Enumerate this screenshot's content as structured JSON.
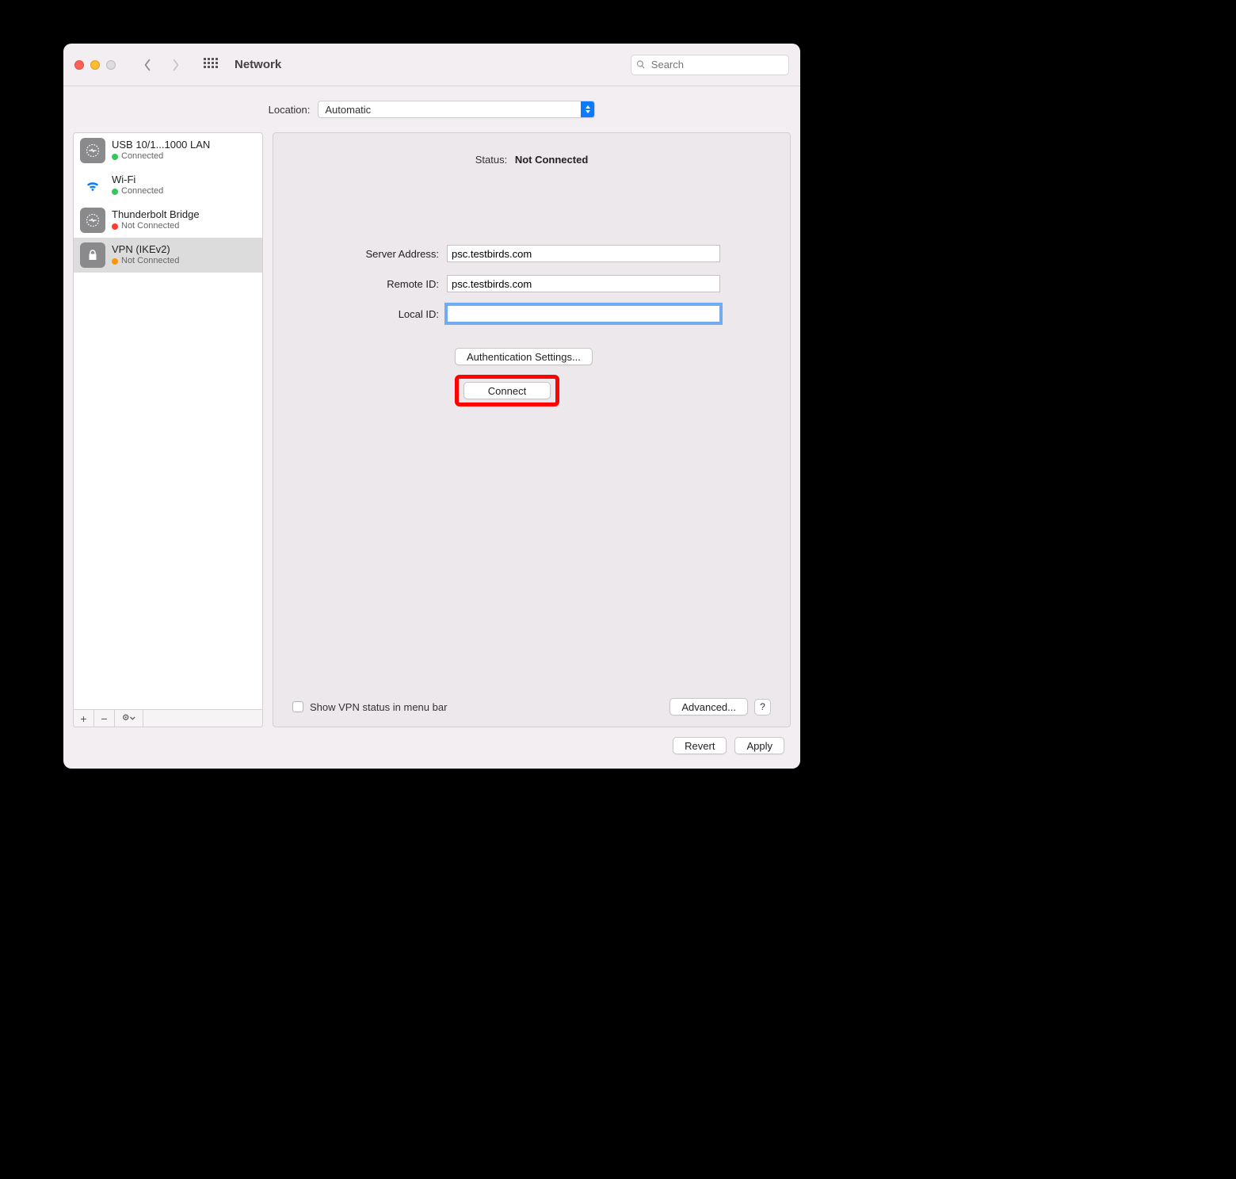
{
  "toolbar": {
    "title": "Network",
    "search_placeholder": "Search"
  },
  "location": {
    "label": "Location:",
    "value": "Automatic"
  },
  "services": [
    {
      "name": "USB 10/1...1000 LAN",
      "status": "Connected",
      "dot": "green",
      "icon": "ethernet"
    },
    {
      "name": "Wi-Fi",
      "status": "Connected",
      "dot": "green",
      "icon": "wifi"
    },
    {
      "name": "Thunderbolt Bridge",
      "status": "Not Connected",
      "dot": "red",
      "icon": "ethernet"
    },
    {
      "name": "VPN (IKEv2)",
      "status": "Not Connected",
      "dot": "orange",
      "icon": "lock",
      "selected": true
    }
  ],
  "detail": {
    "status_label": "Status:",
    "status_value": "Not Connected",
    "fields": {
      "server_address_label": "Server Address:",
      "server_address_value": "psc.testbirds.com",
      "remote_id_label": "Remote ID:",
      "remote_id_value": "psc.testbirds.com",
      "local_id_label": "Local ID:",
      "local_id_value": ""
    },
    "auth_button": "Authentication Settings...",
    "connect_button": "Connect",
    "show_status_label": "Show VPN status in menu bar",
    "advanced_button": "Advanced...",
    "help_button": "?"
  },
  "footer": {
    "revert": "Revert",
    "apply": "Apply"
  },
  "highlight": {
    "target": "connect_button",
    "color": "#ff0202"
  }
}
